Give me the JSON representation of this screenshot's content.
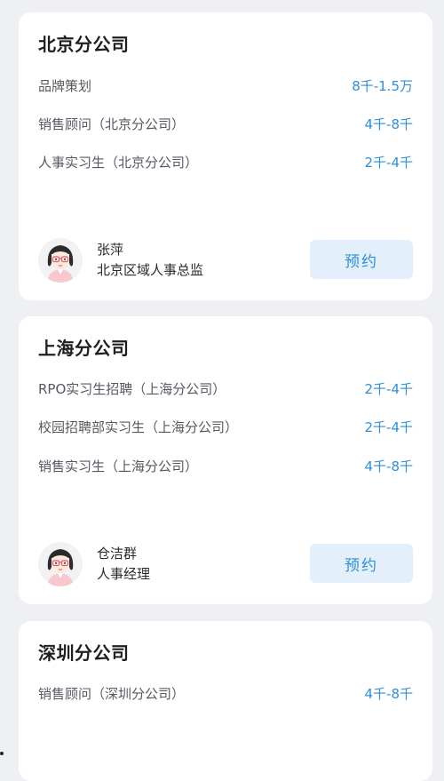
{
  "branches": [
    {
      "name": "北京分公司",
      "jobs": [
        {
          "title": "品牌策划",
          "salary": "8千-1.5万"
        },
        {
          "title": "销售顾问（北京分公司）",
          "salary": "4千-8千"
        },
        {
          "title": "人事实习生（北京分公司）",
          "salary": "2千-4千"
        }
      ],
      "contact": {
        "name": "张萍",
        "role": "北京区域人事总监",
        "avatar_icon": "woman-avatar-icon"
      },
      "book_label": "预约"
    },
    {
      "name": "上海分公司",
      "jobs": [
        {
          "title": "RPO实习生招聘（上海分公司）",
          "salary": "2千-4千"
        },
        {
          "title": "校园招聘部实习生（上海分公司）",
          "salary": "2千-4千"
        },
        {
          "title": "销售实习生（上海分公司）",
          "salary": "4千-8千"
        }
      ],
      "contact": {
        "name": "仓洁群",
        "role": "人事经理",
        "avatar_icon": "woman-avatar-icon"
      },
      "book_label": "预约"
    },
    {
      "name": "深圳分公司",
      "jobs": [
        {
          "title": "销售顾问（深圳分公司）",
          "salary": "4千-8千"
        }
      ]
    }
  ],
  "colors": {
    "accent": "#2e8fd6",
    "button_bg": "#e3f0fb",
    "page_bg": "#eef0f3",
    "card_bg": "#ffffff"
  }
}
